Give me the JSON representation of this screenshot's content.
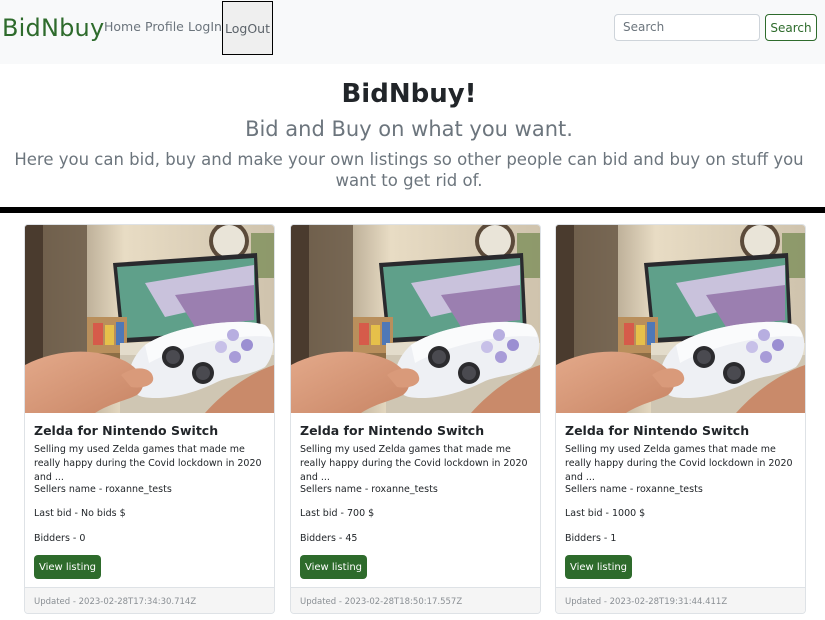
{
  "navbar": {
    "brand": "BidNbuy",
    "links": [
      "Home",
      "Profile",
      "LogIn"
    ],
    "logout_label": "LogOut",
    "search_placeholder": "Search",
    "search_button": "Search"
  },
  "hero": {
    "title": "BidNbuy!",
    "subtitle": "Bid and Buy on what you want.",
    "text": "Here you can bid, buy and make your own listings so other people can bid and buy on stuff you want to get rid of."
  },
  "colors": {
    "accent": "#2e6b2c",
    "navbar_bg": "#f8f9fa",
    "muted_text": "#6c757d"
  },
  "listings": [
    {
      "title": "Zelda for Nintendo Switch",
      "description": "Selling my used Zelda games that made me really happy during the Covid lockdown in 2020 and ...",
      "seller": "Sellers name - roxanne_tests",
      "last_bid": "Last bid - No bids $",
      "bidders": "Bidders - 0",
      "button": "View listing",
      "updated": "Updated - 2023-02-28T17:34:30.714Z",
      "image_icon": "game-controller-photo"
    },
    {
      "title": "Zelda for Nintendo Switch",
      "description": "Selling my used Zelda games that made me really happy during the Covid lockdown in 2020 and ...",
      "seller": "Sellers name - roxanne_tests",
      "last_bid": "Last bid - 700 $",
      "bidders": "Bidders - 45",
      "button": "View listing",
      "updated": "Updated - 2023-02-28T18:50:17.557Z",
      "image_icon": "game-controller-photo"
    },
    {
      "title": "Zelda for Nintendo Switch",
      "description": "Selling my used Zelda games that made me really happy during the Covid lockdown in 2020 and ...",
      "seller": "Sellers name - roxanne_tests",
      "last_bid": "Last bid - 1000 $",
      "bidders": "Bidders - 1",
      "button": "View listing",
      "updated": "Updated - 2023-02-28T19:31:44.411Z",
      "image_icon": "game-controller-photo"
    }
  ]
}
